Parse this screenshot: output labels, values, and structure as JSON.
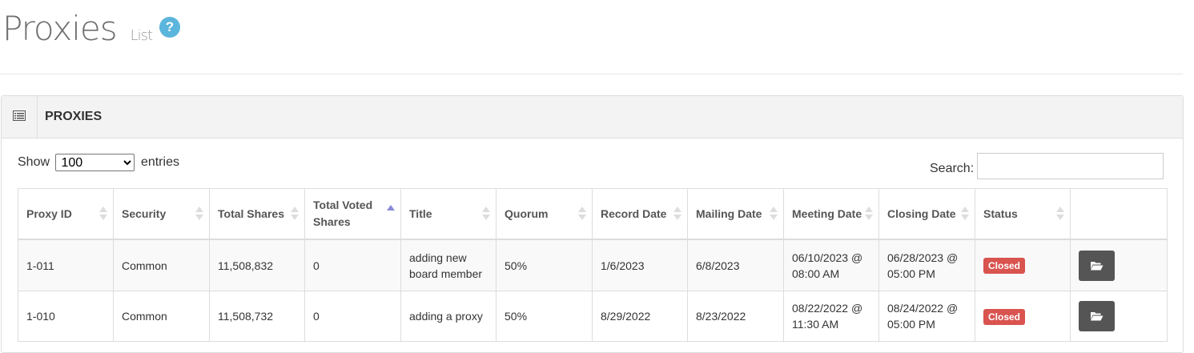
{
  "header": {
    "title": "Proxies",
    "subtitle": "List",
    "help_label": "?"
  },
  "panel": {
    "title": "PROXIES"
  },
  "length": {
    "prefix": "Show",
    "value": "100",
    "suffix": "entries",
    "options": [
      "100"
    ]
  },
  "search": {
    "label": "Search:",
    "value": ""
  },
  "table": {
    "columns": [
      "Proxy ID",
      "Security",
      "Total Shares",
      "Total Voted Shares",
      "Title",
      "Quorum",
      "Record Date",
      "Mailing Date",
      "Meeting Date",
      "Closing Date",
      "Status",
      ""
    ],
    "sorted_column": "Total Voted Shares",
    "sort_direction": "ascending",
    "rows": [
      {
        "proxy_id": "1-011",
        "security": "Common",
        "total_shares": "11,508,832",
        "voted_shares": "0",
        "title": "adding new board member",
        "quorum": "50%",
        "record_date": "1/6/2023",
        "mailing_date": "6/8/2023",
        "meeting_date": "06/10/2023 @ 08:00 AM",
        "closing_date": "06/28/2023 @ 05:00 PM",
        "status": "Closed"
      },
      {
        "proxy_id": "1-010",
        "security": "Common",
        "total_shares": "11,508,732",
        "voted_shares": "0",
        "title": "adding a proxy",
        "quorum": "50%",
        "record_date": "8/29/2022",
        "mailing_date": "8/23/2022",
        "meeting_date": "08/22/2022 @ 11:30 AM",
        "closing_date": "08/24/2022 @ 05:00 PM",
        "status": "Closed"
      }
    ]
  },
  "colors": {
    "help_icon": "#5bb5dc",
    "status_closed": "#d9534f",
    "action_button": "#555555",
    "sort_active": "#8a8ad8"
  },
  "icons": {
    "panel": "list-icon",
    "action": "folder-open-icon",
    "help": "question-circle-icon"
  }
}
